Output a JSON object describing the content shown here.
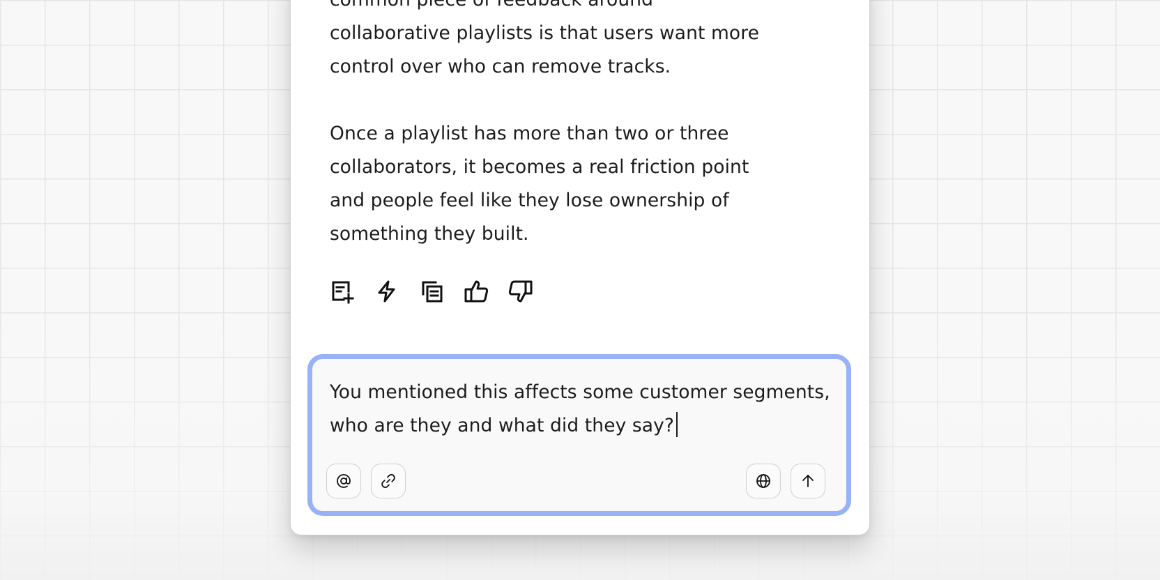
{
  "message": {
    "paragraph1_lines": [
      "common piece of feedback around",
      "collaborative playlists is that users want more",
      "control over who can remove tracks."
    ],
    "paragraph2_lines": [
      "Once a playlist has more than two or three",
      "collaborators, it becomes a real friction point",
      "and people feel like they lose ownership of",
      "something they built."
    ]
  },
  "message_actions": [
    {
      "icon": "add-note-icon"
    },
    {
      "icon": "lightning-icon"
    },
    {
      "icon": "copy-icon"
    },
    {
      "icon": "thumbs-up-icon"
    },
    {
      "icon": "thumbs-down-icon"
    }
  ],
  "composer": {
    "line1": "You mentioned this affects some customer segments,",
    "line2": "who are they and what did they say?",
    "left_tools": [
      {
        "icon": "at-mention-icon"
      },
      {
        "icon": "link-icon"
      }
    ],
    "right_tools": [
      {
        "icon": "globe-icon"
      },
      {
        "icon": "arrow-up-icon"
      }
    ]
  },
  "colors": {
    "focus_ring": "#98b2f6",
    "text": "#1c1c1c",
    "panel_bg": "#ffffff",
    "composer_bg": "#f9f9f9"
  }
}
